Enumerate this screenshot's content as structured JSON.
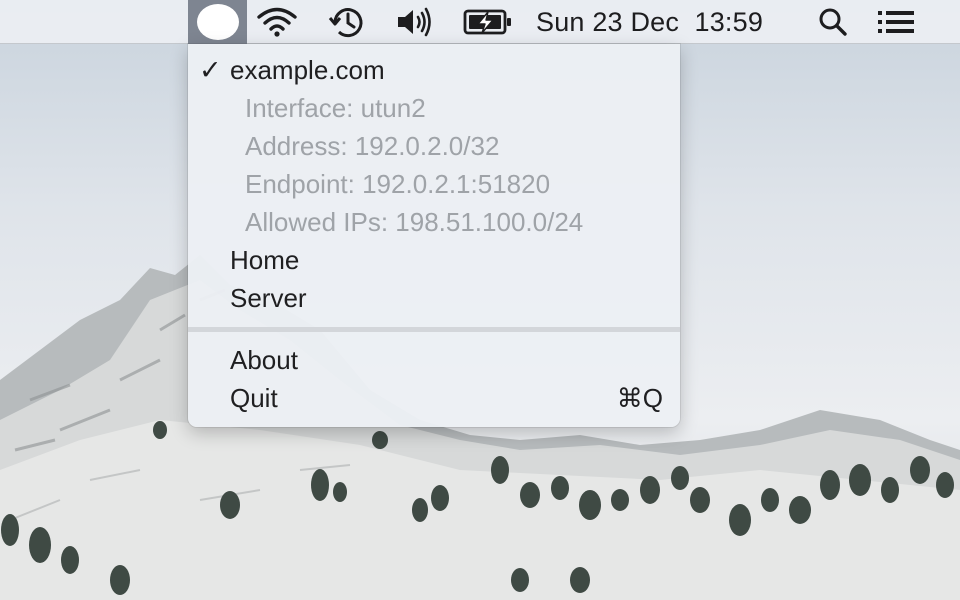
{
  "menubar": {
    "status_items": [
      {
        "name": "app-status-item",
        "icon": "white-circle-icon",
        "active": true
      },
      {
        "name": "wifi-status-item",
        "icon": "wifi-icon"
      },
      {
        "name": "time-machine-status-item",
        "icon": "time-machine-icon"
      },
      {
        "name": "volume-status-item",
        "icon": "speaker-volume-icon"
      },
      {
        "name": "battery-status-item",
        "icon": "battery-charging-icon"
      }
    ],
    "clock": "Sun 23 Dec  13:59",
    "spotlight_icon": "search-icon",
    "notification_icon": "list-icon"
  },
  "menu": {
    "tunnel": {
      "name": "example.com",
      "checked": true,
      "checkmark": "✓",
      "details": {
        "interface": "Interface: utun2",
        "address": "Address: 192.0.2.0/32",
        "endpoint": "Endpoint: 192.0.2.1:51820",
        "allowed_ips": "Allowed IPs: 198.51.100.0/24"
      }
    },
    "other_tunnels": [
      "Home",
      "Server"
    ],
    "about": "About",
    "quit": "Quit",
    "quit_shortcut": "⌘Q"
  },
  "colors": {
    "menubar_bg": "#eceff3",
    "active_item_bg": "#7e8591",
    "menu_text": "#1f1f21",
    "disabled_text": "#9fa3a8"
  }
}
